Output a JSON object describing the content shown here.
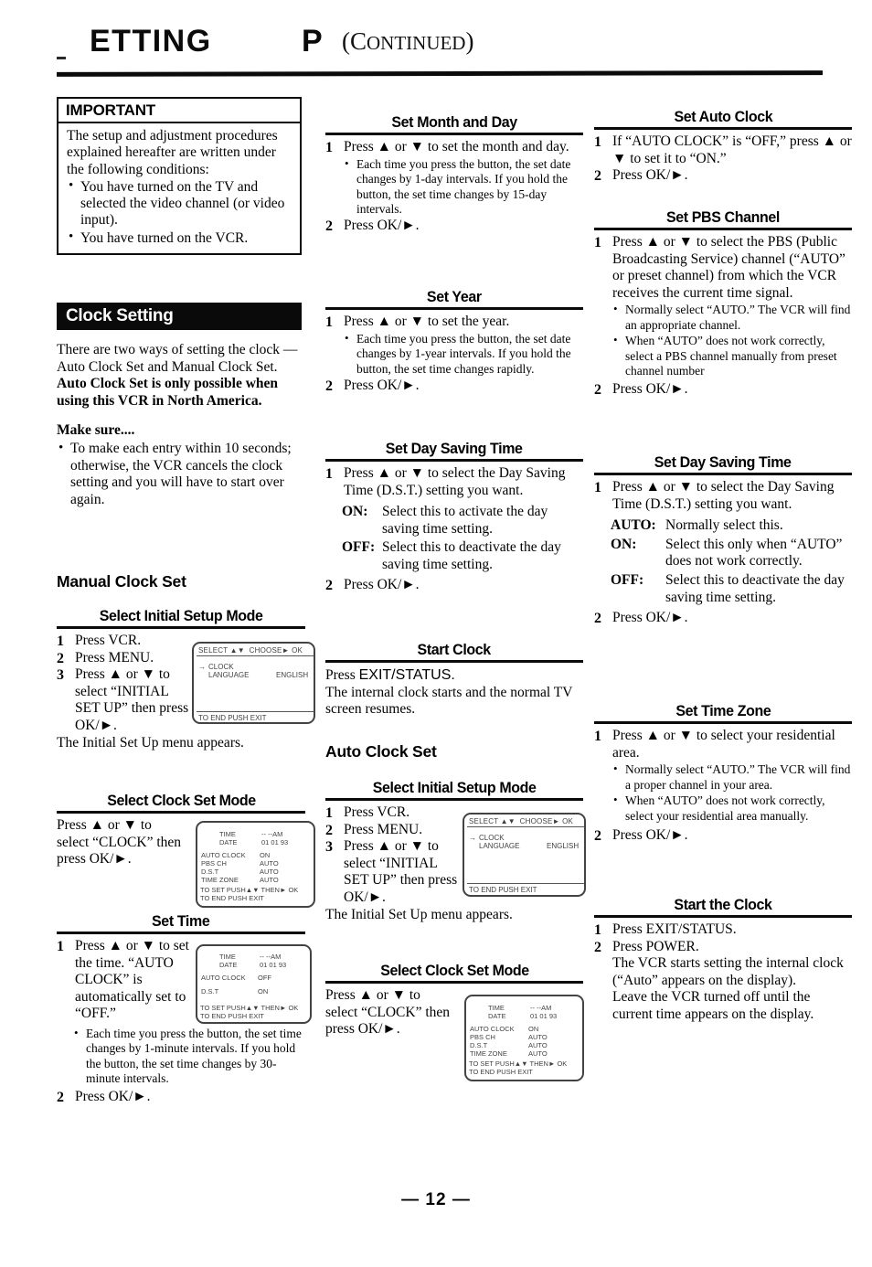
{
  "header": {
    "title": "ETTING",
    "title_p": "P",
    "continued_open": "(C",
    "continued_small": "ONTINUED",
    "continued_close": ")"
  },
  "important_box": {
    "title": "IMPORTANT",
    "intro": "The setup and adjustment procedures explained hereafter are written under the following conditions:",
    "bullets": [
      "You have turned on the TV and selected the video channel (or video input).",
      "You have turned on the VCR."
    ]
  },
  "clock_setting": {
    "section_title": "Clock Setting",
    "intro": "There are two ways of setting the clock — Auto Clock Set and Manual Clock Set.",
    "intro_bold": "Auto Clock Set is only possible when using this VCR in North America.",
    "make_sure_title": "Make sure....",
    "make_sure_bullets": [
      "To make each entry within 10 seconds; otherwise, the VCR cancels the clock setting and you will have to start over again."
    ]
  },
  "manual_clock_set": {
    "title": "Manual Clock Set",
    "select_initial_setup_mode": {
      "heading": "Select Initial Setup Mode",
      "steps": [
        {
          "num": "1",
          "text": "Press VCR.",
          "sans_part": "VCR."
        },
        {
          "num": "2",
          "text": "Press MENU.",
          "sans_part": "MENU."
        },
        {
          "num": "3",
          "text": "Press ▲ or ▼ to select “INITIAL SET UP” then press OK/►."
        }
      ],
      "note": "The Initial Set Up menu appears."
    },
    "select_clock_set_mode": {
      "heading": "Select Clock Set Mode",
      "body": "Press ▲ or ▼ to select “CLOCK” then press OK/►."
    },
    "set_time": {
      "heading": "Set Time",
      "steps": [
        {
          "num": "1",
          "text": "Press ▲ or ▼ to set the time. “AUTO CLOCK” is automatically set to “OFF.”"
        },
        {
          "num": "2",
          "text": "Press OK/►."
        }
      ],
      "bullets": [
        "Each time you press the button, the set time changes by 1-minute intervals. If you hold the button, the set time changes by 30-minute intervals."
      ]
    }
  },
  "middle_column": {
    "set_month_and_day": {
      "heading": "Set Month and Day",
      "steps": [
        {
          "num": "1",
          "text": "Press ▲ or ▼ to set the month and day."
        },
        {
          "num": "2",
          "text": "Press OK/►."
        }
      ],
      "bullets": [
        "Each time you press the button, the set date changes by 1-day intervals. If you hold the button, the set time changes by 15-day intervals."
      ]
    },
    "set_year": {
      "heading": "Set Year",
      "steps": [
        {
          "num": "1",
          "text": "Press ▲ or ▼ to set the year."
        },
        {
          "num": "2",
          "text": "Press OK/►."
        }
      ],
      "bullets": [
        "Each time you press the button, the set date changes by 1-year intervals. If you hold the button, the set time changes rapidly."
      ]
    },
    "set_day_saving_time": {
      "heading": "Set Day Saving Time",
      "step1_num": "1",
      "step1": "Press ▲ or ▼ to select the Day Saving Time (D.S.T.) setting you want.",
      "options": [
        {
          "label": "ON:",
          "desc": "Select this to activate the day saving time setting."
        },
        {
          "label": "OFF:",
          "desc": "Select this to deactivate the day saving time setting."
        }
      ],
      "step2_num": "2",
      "step2": "Press OK/►."
    },
    "start_clock": {
      "heading": "Start Clock",
      "line1_pre": "Press ",
      "line1_sans": "EXIT/STATUS.",
      "line2": "The internal clock starts and the normal TV screen resumes."
    },
    "auto_clock_set": {
      "title": "Auto Clock Set",
      "select_initial_setup_mode": {
        "heading": "Select Initial Setup Mode",
        "steps": [
          {
            "num": "1",
            "text": "Press VCR.",
            "sans_part": "VCR."
          },
          {
            "num": "2",
            "text": "Press MENU.",
            "sans_part": "MENU."
          },
          {
            "num": "3",
            "text": "Press ▲ or ▼ to select “INITIAL SET UP” then press OK/►."
          }
        ],
        "note": "The Initial Set Up menu appears."
      },
      "select_clock_set_mode": {
        "heading": "Select Clock Set Mode",
        "body": "Press ▲ or ▼ to select “CLOCK” then press OK/►."
      }
    }
  },
  "right_column": {
    "set_auto_clock": {
      "heading": "Set Auto Clock",
      "steps": [
        {
          "num": "1",
          "text": "If “AUTO CLOCK” is “OFF,” press ▲ or ▼ to set it to “ON.”"
        },
        {
          "num": "2",
          "text": "Press OK/►."
        }
      ]
    },
    "set_pbs_channel": {
      "heading": "Set PBS Channel",
      "step1_num": "1",
      "step1": "Press ▲ or ▼ to select the PBS (Public Broadcasting Service) channel (“AUTO” or preset channel) from which the VCR receives the current time signal.",
      "bullets": [
        "Normally select “AUTO.” The VCR will find an appropriate channel.",
        "When “AUTO” does not work correctly, select a PBS channel manually from preset channel number"
      ],
      "step2_num": "2",
      "step2": "Press OK/►."
    },
    "set_day_saving_time": {
      "heading": "Set Day Saving Time",
      "step1_num": "1",
      "step1": "Press ▲ or ▼ to select the Day Saving Time (D.S.T.) setting you want.",
      "options": [
        {
          "label": "AUTO:",
          "desc": "Normally select this."
        },
        {
          "label": "ON:",
          "desc": "Select this only when “AUTO” does not work correctly."
        },
        {
          "label": "OFF:",
          "desc": "Select this to deactivate the day saving time setting."
        }
      ],
      "step2_num": "2",
      "step2": "Press OK/►."
    },
    "set_time_zone": {
      "heading": "Set Time Zone",
      "step1_num": "1",
      "step1": "Press ▲ or ▼ to select your residential area.",
      "bullets": [
        "Normally select “AUTO.” The VCR will find a proper channel in your area.",
        "When “AUTO” does not work correctly, select your residential area manually."
      ],
      "step2_num": "2",
      "step2": "Press OK/►."
    },
    "start_the_clock": {
      "heading": "Start the Clock",
      "steps": [
        {
          "num": "1",
          "text": "Press EXIT/STATUS.",
          "sans_part": "EXIT/STATUS."
        },
        {
          "num": "2",
          "text": "Press POWER.",
          "sans_part": "POWER."
        }
      ],
      "note1": "The VCR starts setting the internal clock (“Auto” appears on the display).",
      "note2": "Leave the VCR turned off until the current time appears on the display."
    }
  },
  "osd_screens": {
    "initial_setup": {
      "top_bar": "SELECT ▲▼  CHOOSE► OK",
      "arrow": "→",
      "item1": "CLOCK",
      "item2": "LANGUAGE",
      "item2_value": "ENGLISH",
      "bottom_bar": "TO END PUSH EXIT"
    },
    "clock_menu_full": {
      "time_label": "TIME",
      "time_value": "-- --AM",
      "date_label": "DATE",
      "date_value": "01 01 93",
      "rows": [
        {
          "label": "AUTO CLOCK",
          "value": "ON"
        },
        {
          "label": "PBS CH",
          "value": "AUTO"
        },
        {
          "label": "D.S.T",
          "value": "AUTO"
        },
        {
          "label": "TIME ZONE",
          "value": "AUTO"
        }
      ],
      "footer1": "TO SET PUSH▲▼ THEN► OK",
      "footer2": "TO END PUSH EXIT"
    },
    "clock_menu_manual": {
      "time_label": "TIME",
      "time_value": "-- --AM",
      "date_label": "DATE",
      "date_value": "01 01 93",
      "rows": [
        {
          "label": "AUTO CLOCK",
          "value": "OFF"
        },
        {
          "label": "D.S.T",
          "value": "ON"
        }
      ],
      "footer1": "TO SET PUSH▲▼ THEN► OK",
      "footer2": "TO END PUSH EXIT"
    }
  },
  "footer": {
    "page_number": "— 12 —"
  }
}
